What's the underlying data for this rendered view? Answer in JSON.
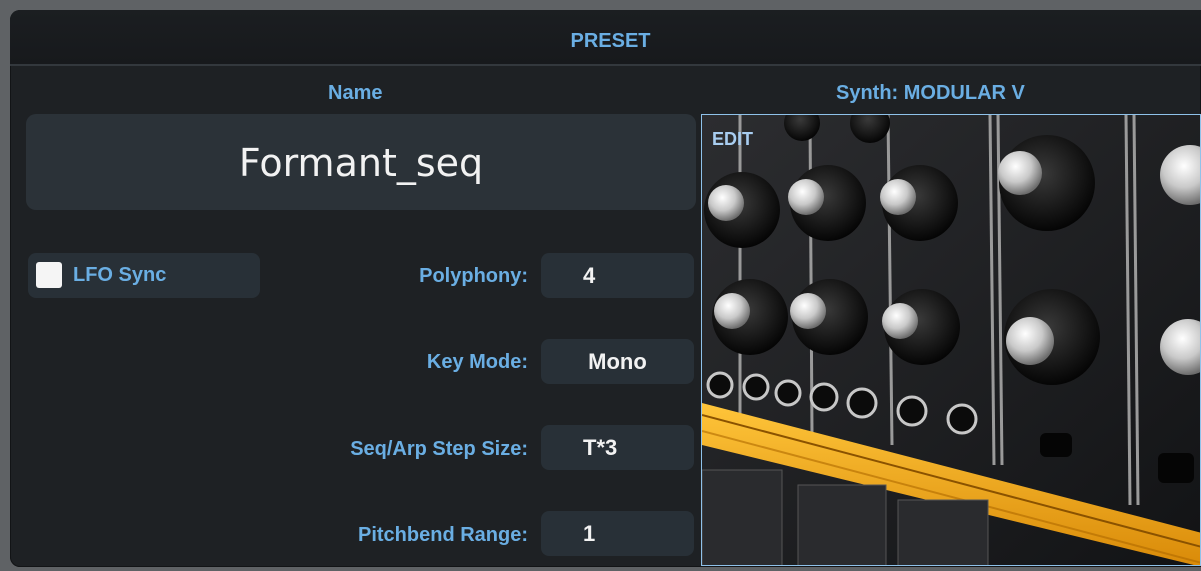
{
  "header": {
    "title": "PRESET"
  },
  "name": {
    "label": "Name",
    "value": "Formant_seq"
  },
  "synth": {
    "label": "Synth: MODULAR V",
    "edit_label": "EDIT"
  },
  "lfo_sync": {
    "label": "LFO Sync",
    "checked": false
  },
  "params": {
    "polyphony": {
      "label": "Polyphony:",
      "value": "4"
    },
    "key_mode": {
      "label": "Key Mode:",
      "value": "Mono"
    },
    "step_size": {
      "label": "Seq/Arp Step Size:",
      "value": "T*3"
    },
    "pitchbend": {
      "label": "Pitchbend Range:",
      "value": "1"
    }
  },
  "colors": {
    "accent": "#6aaee3",
    "panel": "#1e2124",
    "field": "#283037",
    "cable": "#f0a020"
  }
}
